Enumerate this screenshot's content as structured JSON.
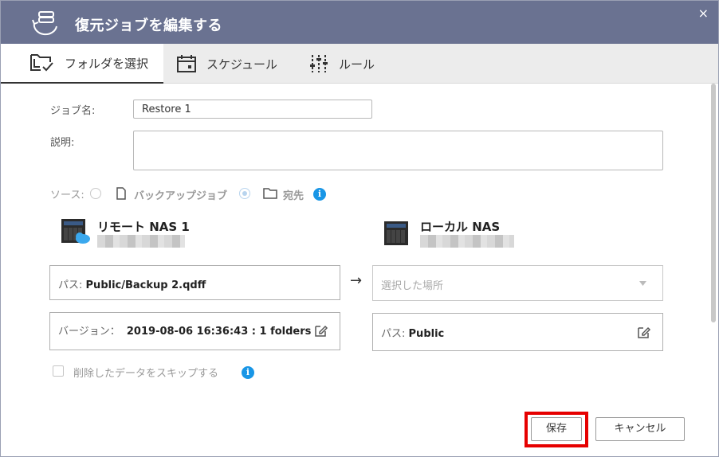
{
  "dialog": {
    "title": "復元ジョブを編集する",
    "close_glyph": "×"
  },
  "tabs": [
    {
      "label": "フォルダを選択",
      "icon": "folder-check-icon",
      "active": true
    },
    {
      "label": "スケジュール",
      "icon": "calendar-icon",
      "active": false
    },
    {
      "label": "ルール",
      "icon": "sliders-icon",
      "active": false
    }
  ],
  "form": {
    "job_name_label": "ジョブ名:",
    "job_name_value": "Restore 1",
    "description_label": "説明:",
    "description_value": "",
    "source_label": "ソース:",
    "source_option_backup": "バックアップジョブ",
    "source_option_dest": "宛先",
    "info_glyph": "i"
  },
  "remote": {
    "name": "リモート NAS 1",
    "path_label": "パス:",
    "path_value": "Public/Backup 2.qdff",
    "version_label": "バージョン：",
    "version_value": "2019-08-06 16:36:43 : 1 folders"
  },
  "arrow": "→",
  "local": {
    "name": "ローカル NAS",
    "location_placeholder": "選択した場所",
    "path_label": "パス:",
    "path_value": "Public"
  },
  "skip_label": "削除したデータをスキップする",
  "buttons": {
    "save": "保存",
    "cancel": "キャンセル"
  },
  "colors": {
    "titlebar": "#6a7291",
    "info": "#1996e6",
    "highlight": "#e60000"
  }
}
